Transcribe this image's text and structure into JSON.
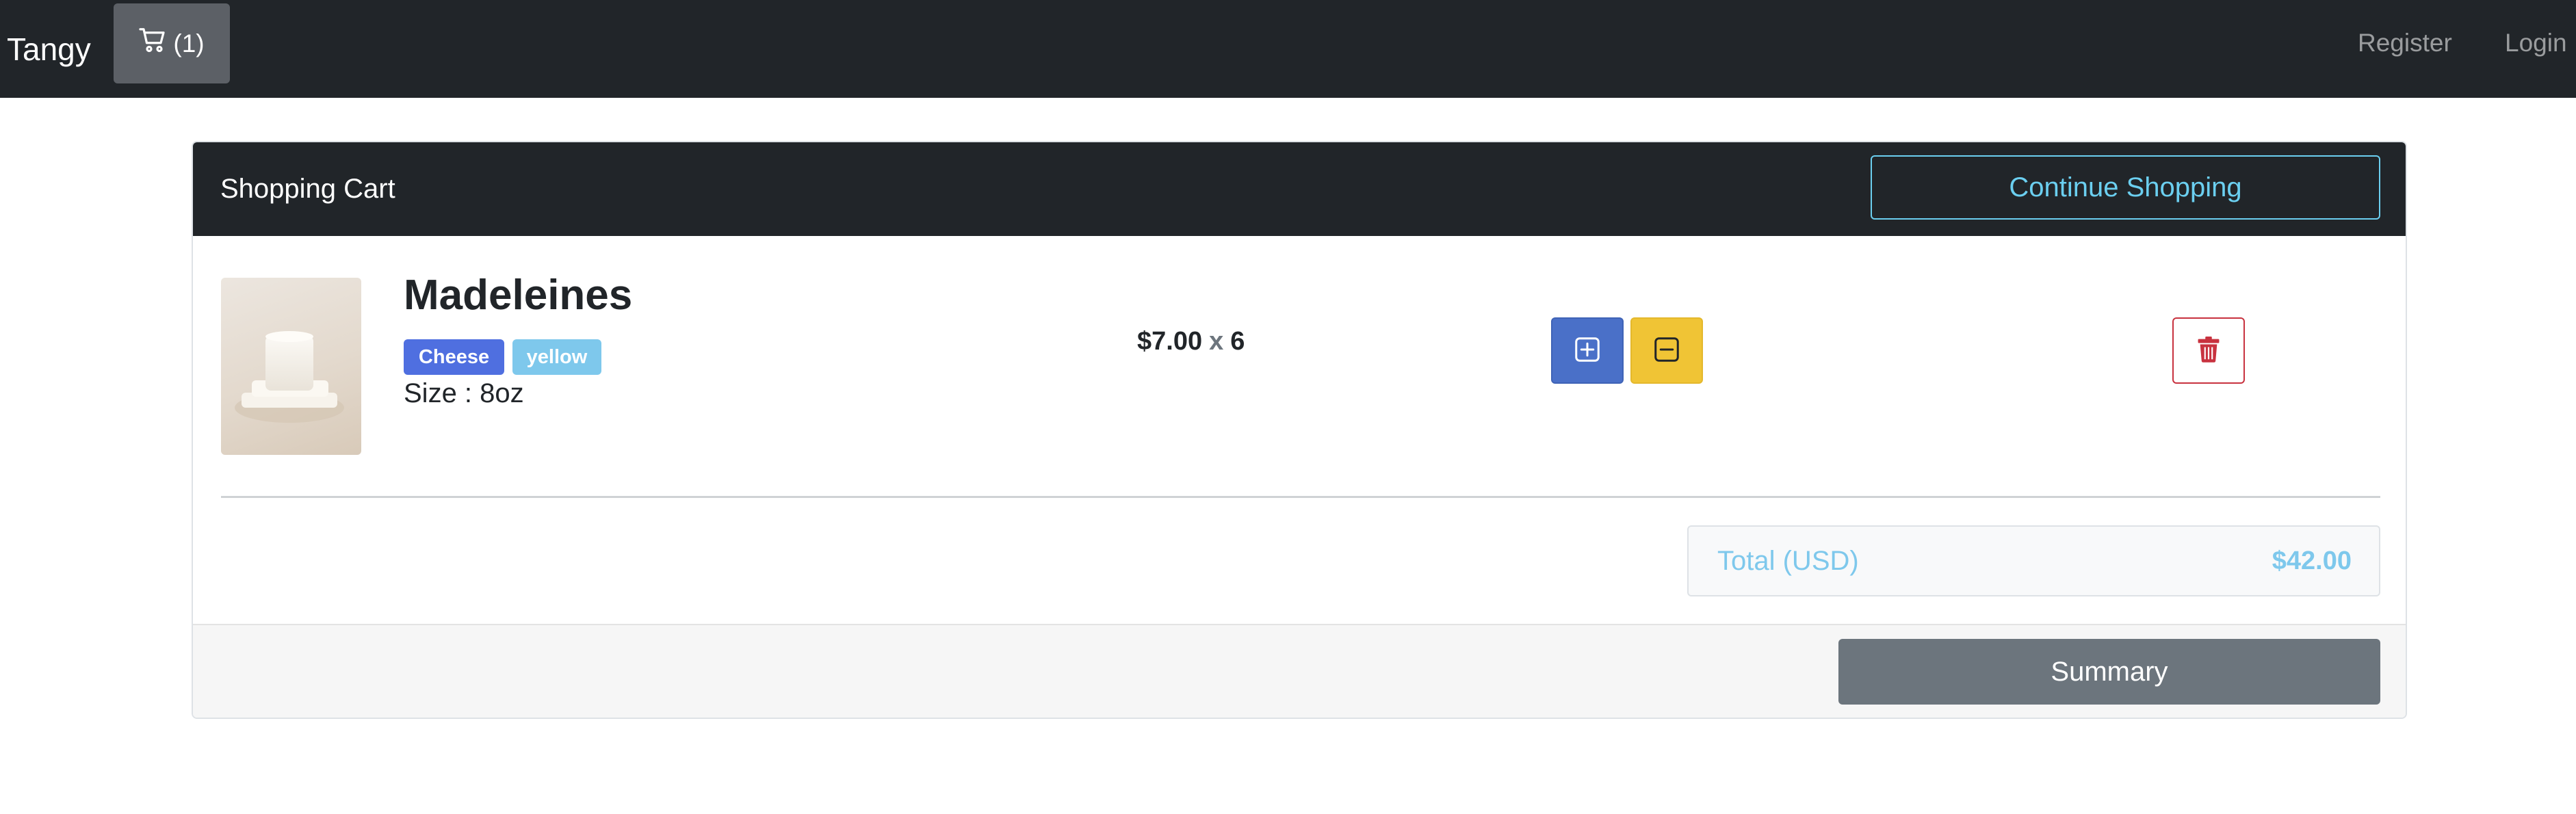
{
  "navbar": {
    "brand": "Tangy",
    "cart_label": "(1)",
    "cart_icon": "cart-icon",
    "links": {
      "register": "Register",
      "login": "Login"
    }
  },
  "cart": {
    "title": "Shopping Cart",
    "continue_label": "Continue Shopping",
    "items": [
      {
        "name": "Madeleines",
        "category_badge": "Cheese",
        "color_badge": "yellow",
        "size_label": "Size : 8oz",
        "price": "$7.00",
        "times": "x",
        "quantity": "6",
        "increase_icon": "plus-square-icon",
        "decrease_icon": "minus-square-icon",
        "delete_icon": "trash-icon"
      }
    ],
    "total": {
      "label": "Total (USD)",
      "value": "$42.00"
    },
    "summary_label": "Summary"
  },
  "colors": {
    "navbar_bg": "#212529",
    "accent_info": "#6bcff0",
    "badge_primary": "#4f6fe0",
    "badge_info": "#7ec8ec",
    "btn_primary": "#4a70c8",
    "btn_warning": "#f0c435",
    "btn_danger": "#c8323f",
    "btn_secondary": "#6c757d"
  }
}
